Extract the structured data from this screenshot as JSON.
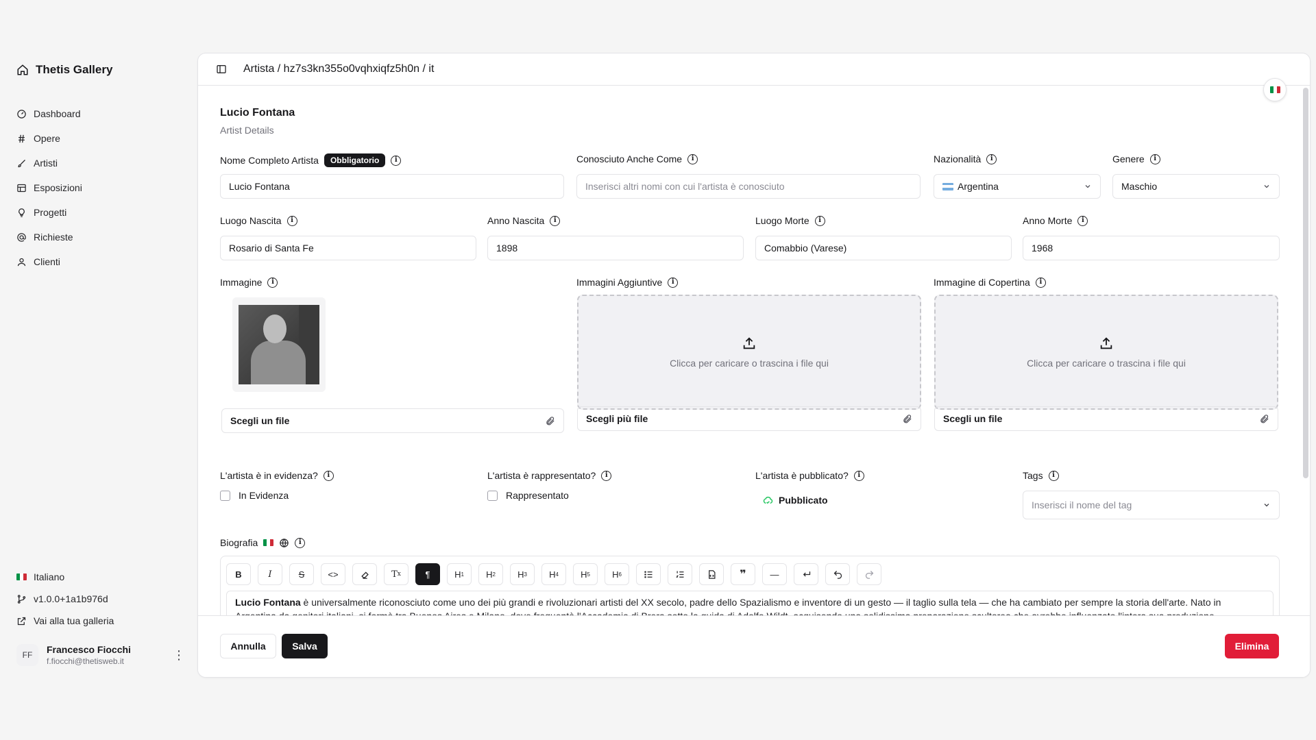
{
  "brand": {
    "name": "Thetis Gallery"
  },
  "nav": [
    {
      "label": "Dashboard",
      "icon": "dashboard-icon"
    },
    {
      "label": "Opere",
      "icon": "hash-icon"
    },
    {
      "label": "Artisti",
      "icon": "brush-icon"
    },
    {
      "label": "Esposizioni",
      "icon": "gallery-icon"
    },
    {
      "label": "Progetti",
      "icon": "lightbulb-icon"
    },
    {
      "label": "Richieste",
      "icon": "at-icon"
    },
    {
      "label": "Clienti",
      "icon": "user-icon"
    }
  ],
  "sidebar_bottom": {
    "language": "Italiano",
    "version": "v1.0.0+1a1b976d",
    "gallery_link": "Vai alla tua galleria"
  },
  "user": {
    "initials": "FF",
    "name": "Francesco Fiocchi",
    "email": "f.fiocchi@thetisweb.it"
  },
  "header": {
    "breadcrumb": "Artista / hz7s3kn355o0vqhxiqfz5h0n / it"
  },
  "page": {
    "title": "Lucio Fontana",
    "subtitle": "Artist Details"
  },
  "fields": {
    "full_name": {
      "label": "Nome Completo Artista",
      "badge": "Obbligatorio",
      "value": "Lucio Fontana"
    },
    "aka": {
      "label": "Conosciuto Anche Come",
      "placeholder": "Inserisci altri nomi con cui l'artista è conosciuto"
    },
    "nationality": {
      "label": "Nazionalità",
      "value": "Argentina"
    },
    "gender": {
      "label": "Genere",
      "value": "Maschio"
    },
    "birth_place": {
      "label": "Luogo Nascita",
      "value": "Rosario di Santa Fe"
    },
    "birth_year": {
      "label": "Anno Nascita",
      "value": "1898"
    },
    "death_place": {
      "label": "Luogo Morte",
      "value": "Comabbio (Varese)"
    },
    "death_year": {
      "label": "Anno Morte",
      "value": "1968"
    },
    "image": {
      "label": "Immagine",
      "file_button": "Scegli un file"
    },
    "extra_images": {
      "label": "Immagini Aggiuntive",
      "drop_text": "Clicca per caricare o trascina i file qui",
      "file_button": "Scegli più file"
    },
    "cover_image": {
      "label": "Immagine di Copertina",
      "drop_text": "Clicca per caricare o trascina i file qui",
      "file_button": "Scegli un file"
    },
    "featured": {
      "label": "L'artista è in evidenza?",
      "option": "In Evidenza"
    },
    "represented": {
      "label": "L'artista è rappresentato?",
      "option": "Rappresentato"
    },
    "published": {
      "label": "L'artista è pubblicato?",
      "value": "Pubblicato"
    },
    "tags": {
      "label": "Tags",
      "placeholder": "Inserisci il nome del tag"
    },
    "biography": {
      "label": "Biografia",
      "bold_lead": "Lucio Fontana",
      "text_1": " è universalmente riconosciuto come uno dei più grandi e rivoluzionari artisti del XX secolo, padre dello Spazialismo e inventore di un gesto — il taglio sulla tela — che ha cambiato per sempre la storia dell'arte. Nato in",
      "text_2": "Argentina da genitori italiani, si formò tra Buenos Aires e Milano, dove frequentò l'Accademia di Brera sotto la guida di Adolfo Wildt, acquisendo una solidissima preparazione scultorea che avrebbe influenzato l'intera sua produzione."
    }
  },
  "toolbar": [
    "B",
    "I",
    "S",
    "<>",
    "eraser",
    "Tx",
    "¶",
    "H1",
    "H2",
    "H3",
    "H4",
    "H5",
    "H6",
    "ul",
    "ol",
    "code-block",
    "quote",
    "hr",
    "break",
    "undo",
    "redo"
  ],
  "footer": {
    "cancel": "Annulla",
    "save": "Salva",
    "delete": "Elimina"
  },
  "colors": {
    "primary": "#18181b",
    "danger": "#e11d38",
    "published": "#22c55e"
  }
}
